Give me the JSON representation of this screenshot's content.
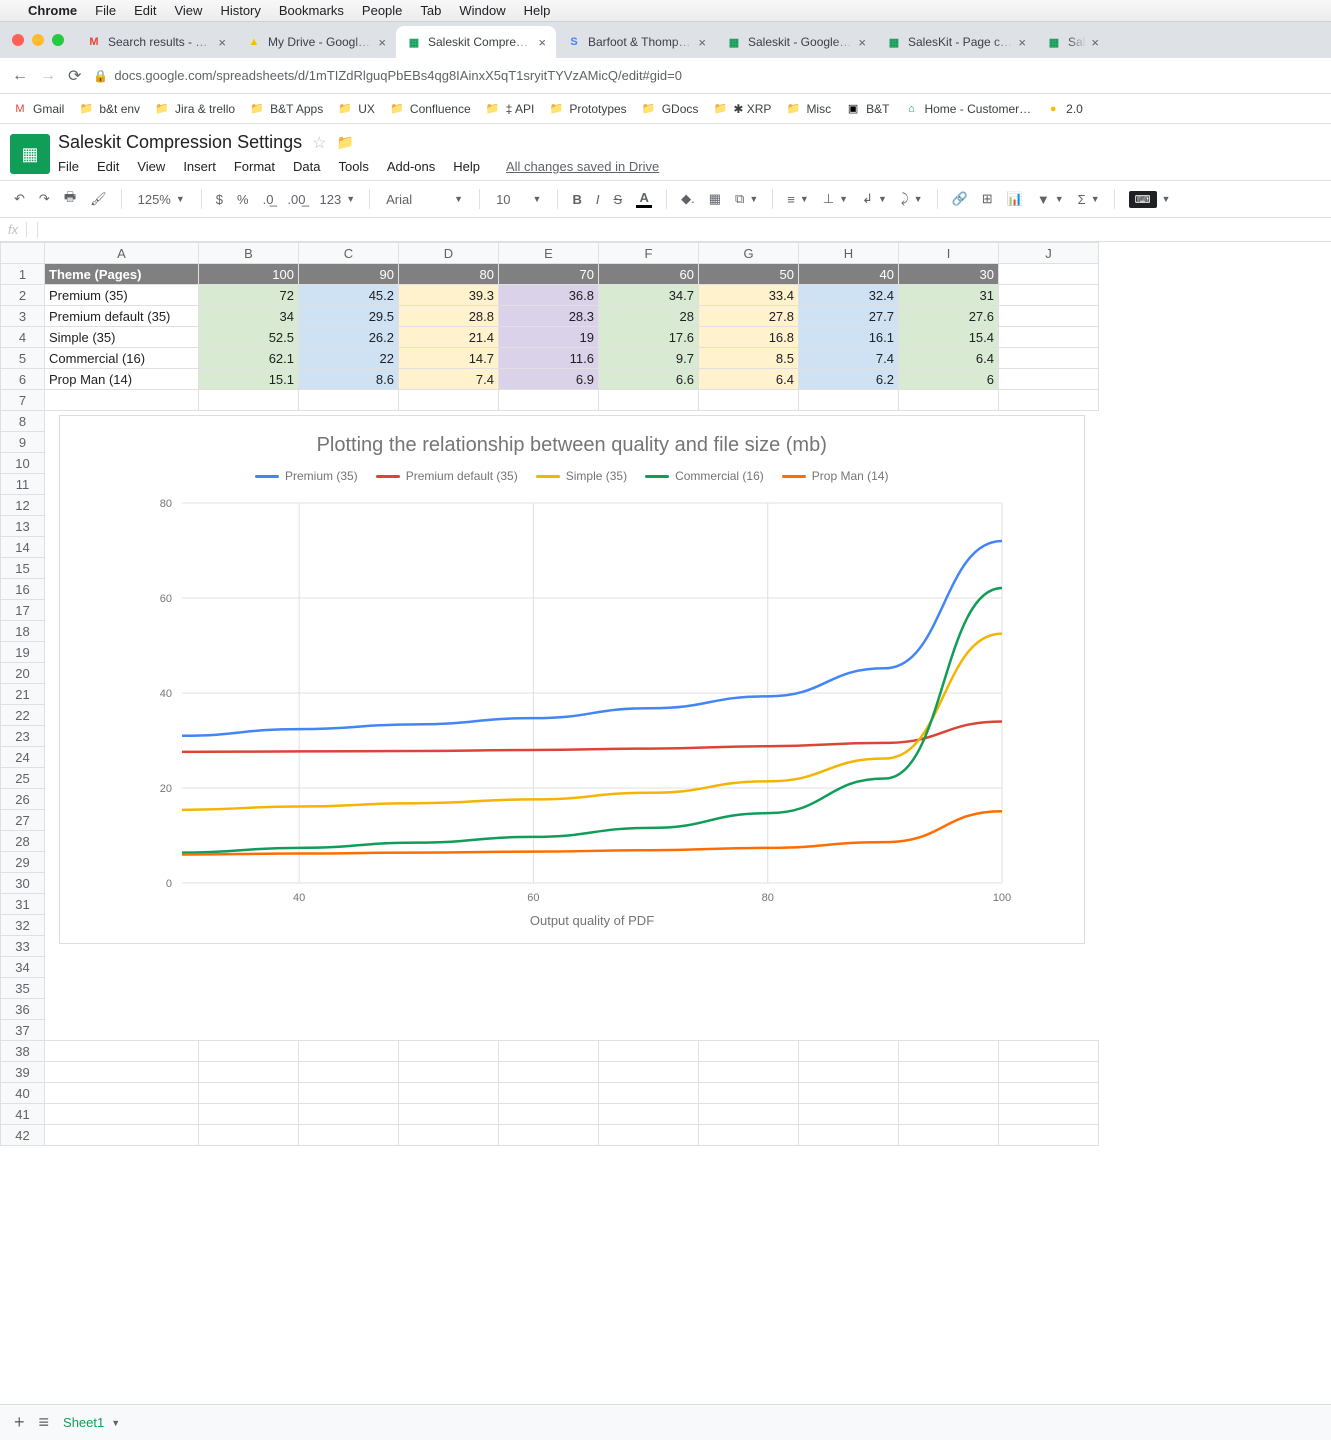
{
  "mac_menu": [
    "Chrome",
    "File",
    "Edit",
    "View",
    "History",
    "Bookmarks",
    "People",
    "Tab",
    "Window",
    "Help"
  ],
  "browser_tabs": [
    {
      "title": "Search results - afindlat",
      "favicon": "M",
      "color": "#ea4335"
    },
    {
      "title": "My Drive - Google Drive",
      "favicon": "▲",
      "color": "#fbbc04"
    },
    {
      "title": "Saleskit Compression S",
      "favicon": "▦",
      "color": "#0f9d58",
      "active": true
    },
    {
      "title": "Barfoot & Thompson - C",
      "favicon": "S",
      "color": "#4285f4"
    },
    {
      "title": "Saleskit - Google Sheet",
      "favicon": "▦",
      "color": "#0f9d58"
    },
    {
      "title": "SalesKit - Page counts",
      "favicon": "▦",
      "color": "#0f9d58"
    },
    {
      "title": "Sal",
      "favicon": "▦",
      "color": "#0f9d58"
    }
  ],
  "url": "docs.google.com/spreadsheets/d/1mTIZdRlguqPbEBs4qg8IAinxX5qT1sryitTYVzAMicQ/edit#gid=0",
  "bookmarks": [
    {
      "label": "Gmail",
      "icon": "M",
      "color": "#ea4335"
    },
    {
      "label": "b&t env",
      "icon": "📁"
    },
    {
      "label": "Jira & trello",
      "icon": "📁"
    },
    {
      "label": "B&T Apps",
      "icon": "📁"
    },
    {
      "label": "UX",
      "icon": "📁"
    },
    {
      "label": "Confluence",
      "icon": "📁"
    },
    {
      "label": "‡ API",
      "icon": "📁"
    },
    {
      "label": "Prototypes",
      "icon": "📁"
    },
    {
      "label": "GDocs",
      "icon": "📁"
    },
    {
      "label": "✱ XRP",
      "icon": "📁"
    },
    {
      "label": "Misc",
      "icon": "📁"
    },
    {
      "label": "B&T",
      "icon": "▣",
      "color": "#000"
    },
    {
      "label": "Home - Customer…",
      "icon": "⌂",
      "color": "#0f9d58"
    },
    {
      "label": "2.0",
      "icon": "●",
      "color": "#fbbc04"
    }
  ],
  "doc": {
    "title": "Saleskit Compression Settings",
    "menus": [
      "File",
      "Edit",
      "View",
      "Insert",
      "Format",
      "Data",
      "Tools",
      "Add-ons",
      "Help"
    ],
    "save_state": "All changes saved in Drive",
    "zoom": "125%",
    "font": "Arial",
    "size": "10"
  },
  "columns": [
    "A",
    "B",
    "C",
    "D",
    "E",
    "F",
    "G",
    "H",
    "I",
    "J"
  ],
  "header_row": [
    "Theme (Pages)",
    "100",
    "90",
    "80",
    "70",
    "60",
    "50",
    "40",
    "30"
  ],
  "data_rows": [
    {
      "label": "Premium (35)",
      "vals": [
        "72",
        "45.2",
        "39.3",
        "36.8",
        "34.7",
        "33.4",
        "32.4",
        "31"
      ]
    },
    {
      "label": "Premium default (35)",
      "vals": [
        "34",
        "29.5",
        "28.8",
        "28.3",
        "28",
        "27.8",
        "27.7",
        "27.6"
      ]
    },
    {
      "label": "Simple (35)",
      "vals": [
        "52.5",
        "26.2",
        "21.4",
        "19",
        "17.6",
        "16.8",
        "16.1",
        "15.4"
      ]
    },
    {
      "label": "Commercial (16)",
      "vals": [
        "62.1",
        "22",
        "14.7",
        "11.6",
        "9.7",
        "8.5",
        "7.4",
        "6.4"
      ]
    },
    {
      "label": "Prop Man (14)",
      "vals": [
        "15.1",
        "8.6",
        "7.4",
        "6.9",
        "6.6",
        "6.4",
        "6.2",
        "6"
      ]
    }
  ],
  "cell_colors": [
    "bg-green",
    "bg-blue",
    "bg-yellow",
    "bg-purple",
    "bg-green",
    "bg-yellow",
    "bg-blue",
    "bg-green"
  ],
  "chart_data": {
    "type": "line",
    "title": "Plotting the relationship between quality and file size (mb)",
    "xlabel": "Output quality of PDF",
    "x": [
      30,
      40,
      50,
      60,
      70,
      80,
      90,
      100
    ],
    "ylim": [
      0,
      80
    ],
    "xticks": [
      40,
      60,
      80,
      100
    ],
    "yticks": [
      0,
      20,
      40,
      60,
      80
    ],
    "series": [
      {
        "name": "Premium (35)",
        "color": "#4285f4",
        "values": [
          31,
          32.4,
          33.4,
          34.7,
          36.8,
          39.3,
          45.2,
          72
        ]
      },
      {
        "name": "Premium default (35)",
        "color": "#db4437",
        "values": [
          27.6,
          27.7,
          27.8,
          28,
          28.3,
          28.8,
          29.5,
          34
        ]
      },
      {
        "name": "Simple (35)",
        "color": "#f4b400",
        "values": [
          15.4,
          16.1,
          16.8,
          17.6,
          19,
          21.4,
          26.2,
          52.5
        ]
      },
      {
        "name": "Commercial (16)",
        "color": "#0f9d58",
        "values": [
          6.4,
          7.4,
          8.5,
          9.7,
          11.6,
          14.7,
          22,
          62.1
        ]
      },
      {
        "name": "Prop Man (14)",
        "color": "#ff6d00",
        "values": [
          6,
          6.2,
          6.4,
          6.6,
          6.9,
          7.4,
          8.6,
          15.1
        ]
      }
    ]
  },
  "sheet_tab": "Sheet1"
}
